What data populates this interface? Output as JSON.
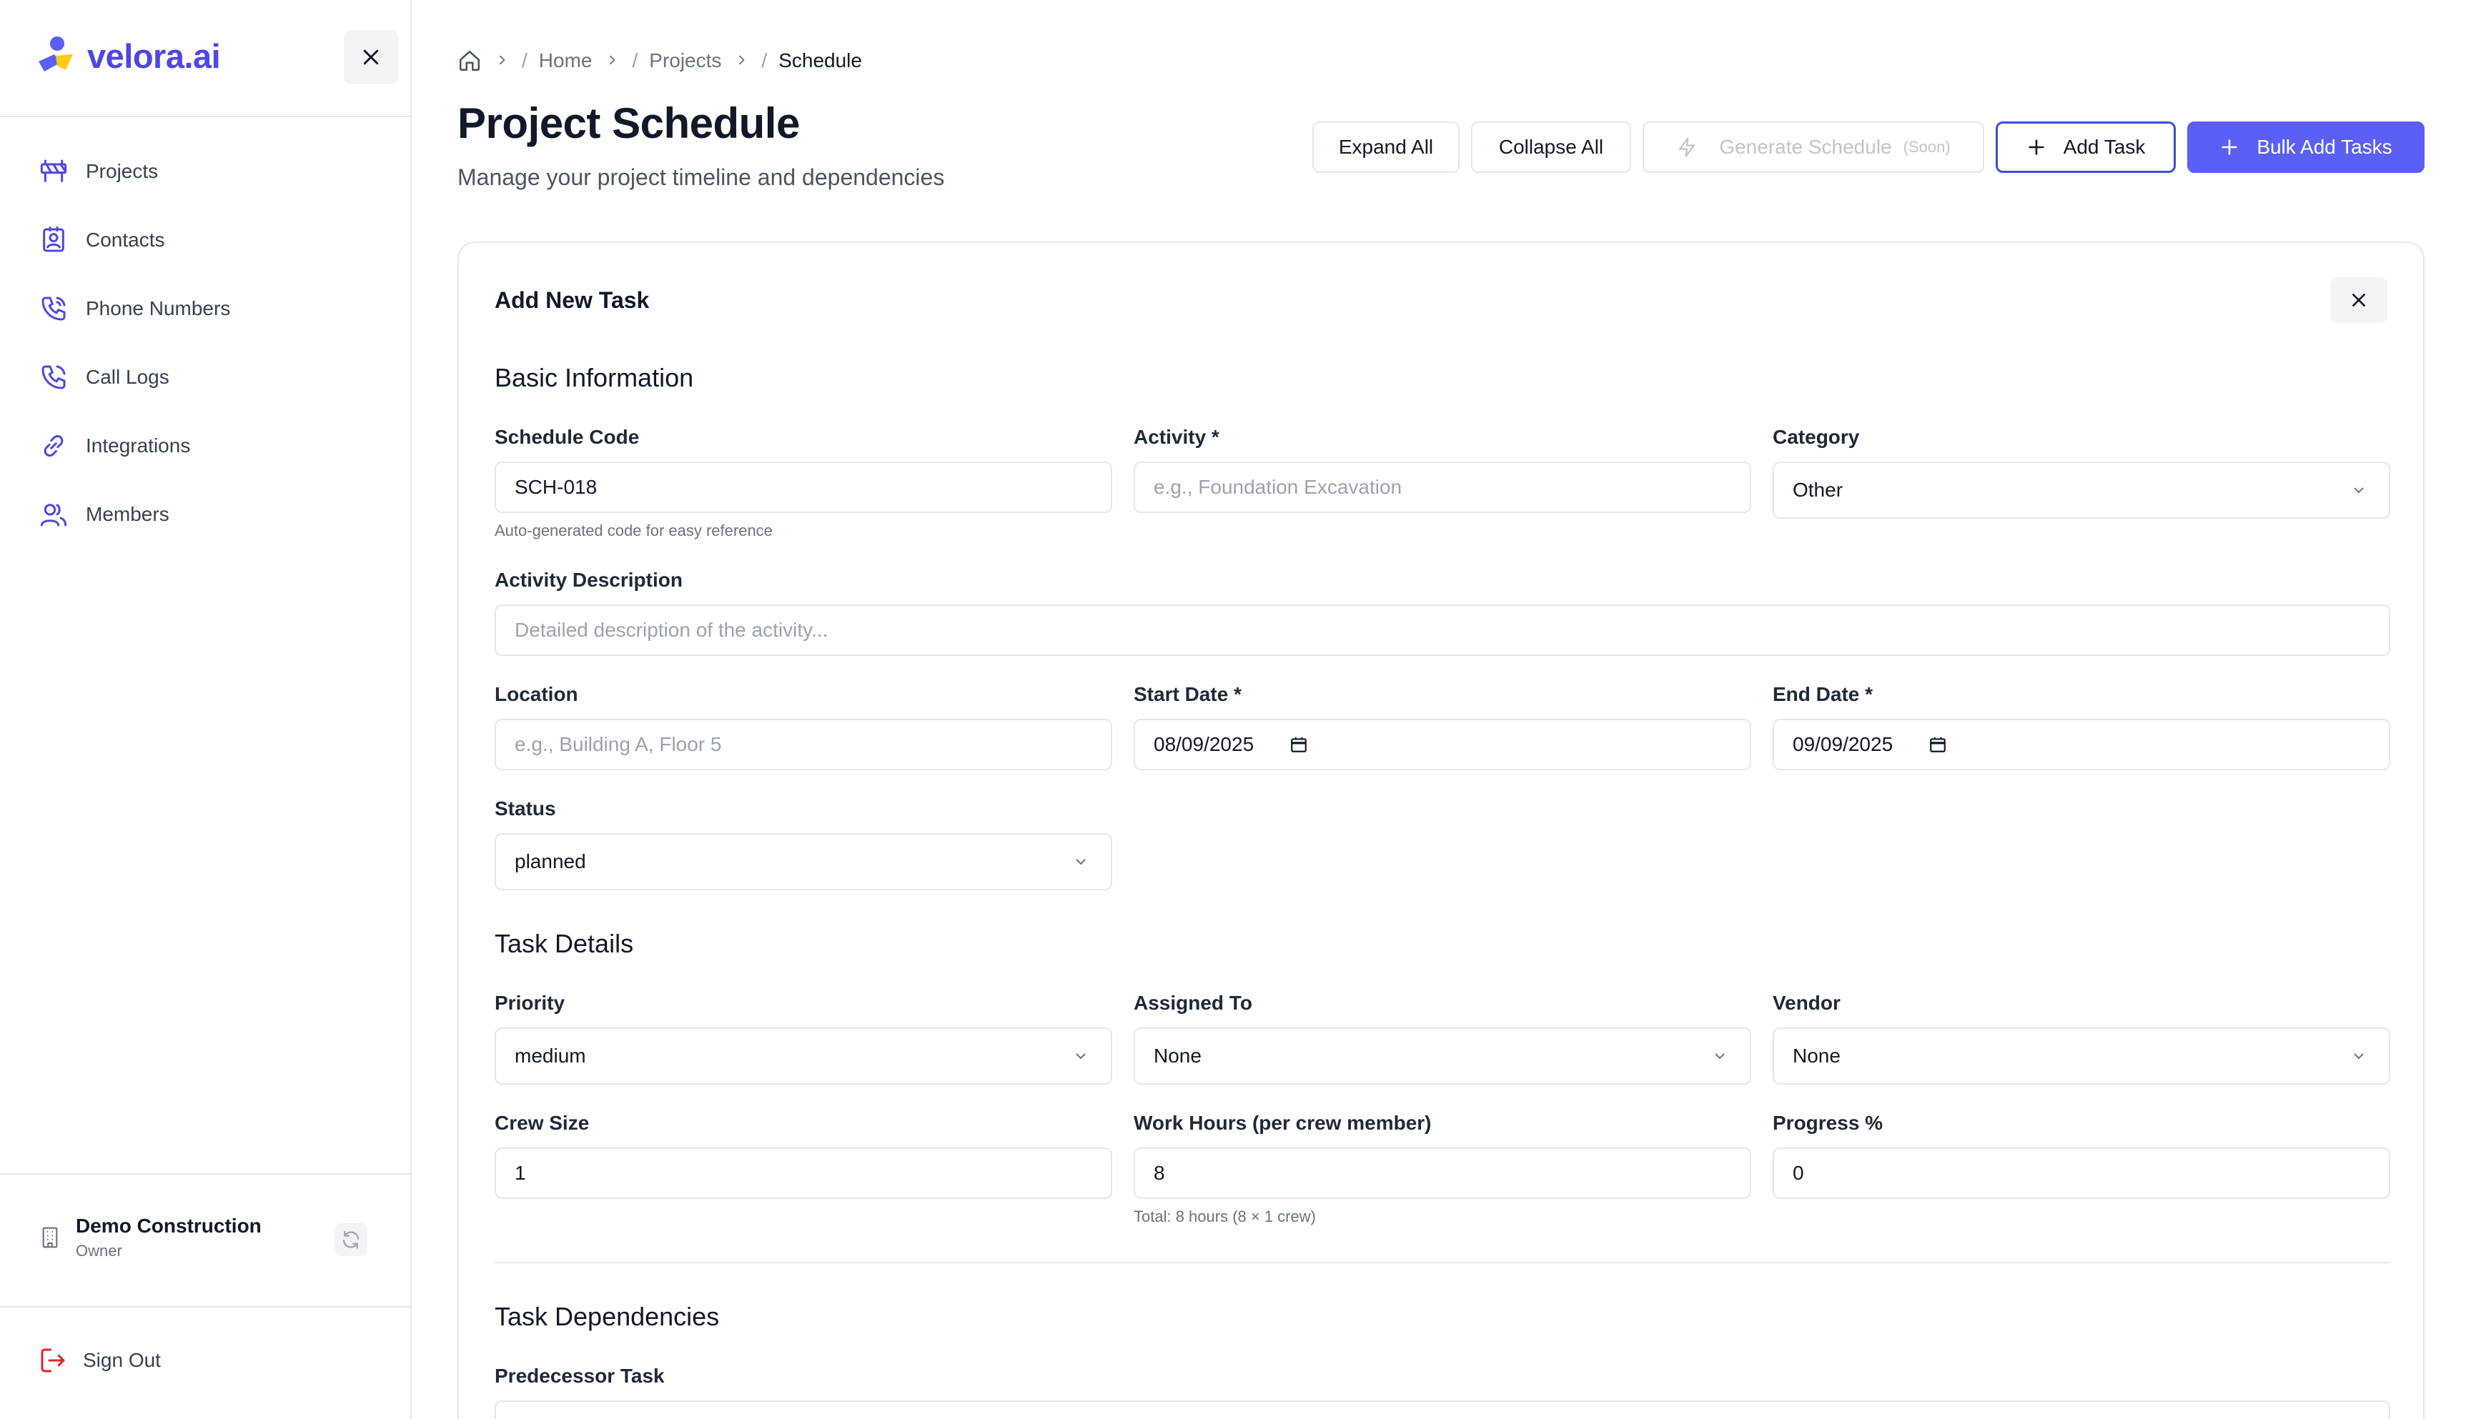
{
  "sidebar": {
    "brand": "velora.ai",
    "nav": [
      {
        "label": "Projects",
        "icon": "construction-icon"
      },
      {
        "label": "Contacts",
        "icon": "contact-card-icon"
      },
      {
        "label": "Phone Numbers",
        "icon": "phone-icon"
      },
      {
        "label": "Call Logs",
        "icon": "phone-log-icon"
      },
      {
        "label": "Integrations",
        "icon": "link-icon"
      },
      {
        "label": "Members",
        "icon": "users-icon"
      }
    ],
    "org": {
      "name": "Demo Construction",
      "role": "Owner"
    },
    "signout": "Sign Out"
  },
  "breadcrumb": {
    "items": [
      "Home",
      "Projects",
      "Schedule"
    ]
  },
  "header": {
    "title": "Project Schedule",
    "subtitle": "Manage your project timeline and dependencies"
  },
  "toolbar": {
    "expand_all": "Expand All",
    "collapse_all": "Collapse All",
    "generate_schedule": "Generate Schedule",
    "generate_badge": "(Soon)",
    "add_task": "Add Task",
    "bulk_add": "Bulk Add Tasks"
  },
  "form": {
    "title": "Add New Task",
    "sections": {
      "basic": "Basic Information",
      "details": "Task Details",
      "dependencies": "Task Dependencies"
    },
    "schedule_code": {
      "label": "Schedule Code",
      "value": "SCH-018",
      "hint": "Auto-generated code for easy reference"
    },
    "activity": {
      "label": "Activity *",
      "placeholder": "e.g., Foundation Excavation"
    },
    "category": {
      "label": "Category",
      "value": "Other"
    },
    "description": {
      "label": "Activity Description",
      "placeholder": "Detailed description of the activity..."
    },
    "location": {
      "label": "Location",
      "placeholder": "e.g., Building A, Floor 5"
    },
    "start_date": {
      "label": "Start Date *",
      "value": "08/09/2025"
    },
    "end_date": {
      "label": "End Date *",
      "value": "09/09/2025"
    },
    "status": {
      "label": "Status",
      "value": "planned"
    },
    "priority": {
      "label": "Priority",
      "value": "medium"
    },
    "assigned_to": {
      "label": "Assigned To",
      "value": "None"
    },
    "vendor": {
      "label": "Vendor",
      "value": "None"
    },
    "crew_size": {
      "label": "Crew Size",
      "value": "1"
    },
    "work_hours": {
      "label": "Work Hours (per crew member)",
      "value": "8",
      "hint": "Total: 8 hours (8 × 1 crew)"
    },
    "progress": {
      "label": "Progress %",
      "value": "0"
    },
    "predecessor": {
      "label": "Predecessor Task"
    }
  },
  "colors": {
    "primary": "#5b5ff5",
    "brand": "#4f46e5",
    "signout": "#dc2626"
  }
}
